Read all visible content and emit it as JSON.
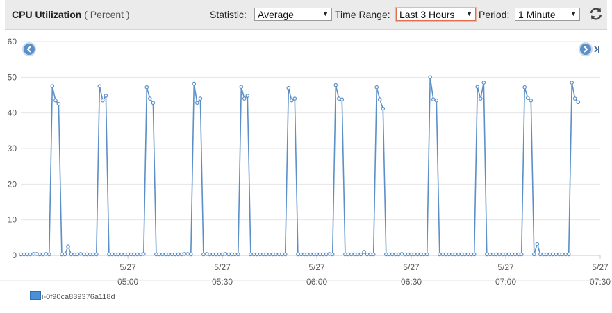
{
  "header": {
    "title": "CPU Utilization",
    "unit": "( Percent )"
  },
  "controls": {
    "statistic_label": "Statistic:",
    "statistic_value": "Average",
    "time_range_label": "Time Range:",
    "time_range_value": "Last 3 Hours",
    "period_label": "Period:",
    "period_value": "1 Minute"
  },
  "icons": {
    "refresh": "refresh-icon",
    "pan_left": "chevron-left-circle-icon",
    "pan_right": "chevron-right-circle-icon",
    "jump_latest": "jump-to-end-icon"
  },
  "colors": {
    "series": "#5b8fc7",
    "accent": "#e0704a"
  },
  "chart_data": {
    "type": "line",
    "title": "",
    "xlabel": "",
    "ylabel": "",
    "ylim": [
      0,
      60
    ],
    "yticks": [
      "0",
      "10",
      "20",
      "30",
      "40",
      "50",
      "60"
    ],
    "xticks": [
      {
        "date": "5/27",
        "time": "05:00"
      },
      {
        "date": "5/27",
        "time": "05:30"
      },
      {
        "date": "5/27",
        "time": "06:00"
      },
      {
        "date": "5/27",
        "time": "06:30"
      },
      {
        "date": "5/27",
        "time": "07:00"
      },
      {
        "date": "5/27",
        "time": "07:30"
      }
    ],
    "x_start": "04:26",
    "x_end": "07:30",
    "grid": true,
    "legend_position": "bottom-left",
    "series": [
      {
        "name": "i-0f90ca839376a118d",
        "times": [
          "04:26",
          "04:27",
          "04:28",
          "04:29",
          "04:30",
          "04:31",
          "04:32",
          "04:33",
          "04:34",
          "04:35",
          "04:36",
          "04:37",
          "04:38",
          "04:39",
          "04:40",
          "04:41",
          "04:42",
          "04:43",
          "04:44",
          "04:45",
          "04:46",
          "04:47",
          "04:48",
          "04:49",
          "04:50",
          "04:51",
          "04:52",
          "04:53",
          "04:54",
          "04:55",
          "04:56",
          "04:57",
          "04:58",
          "04:59",
          "05:00",
          "05:01",
          "05:02",
          "05:03",
          "05:04",
          "05:05",
          "05:06",
          "05:07",
          "05:08",
          "05:09",
          "05:10",
          "05:11",
          "05:12",
          "05:13",
          "05:14",
          "05:15",
          "05:16",
          "05:17",
          "05:18",
          "05:19",
          "05:20",
          "05:21",
          "05:22",
          "05:23",
          "05:24",
          "05:25",
          "05:26",
          "05:27",
          "05:28",
          "05:29",
          "05:30",
          "05:31",
          "05:32",
          "05:33",
          "05:34",
          "05:35",
          "05:36",
          "05:37",
          "05:38",
          "05:39",
          "05:40",
          "05:41",
          "05:42",
          "05:43",
          "05:44",
          "05:45",
          "05:46",
          "05:47",
          "05:48",
          "05:49",
          "05:50",
          "05:51",
          "05:52",
          "05:53",
          "05:54",
          "05:55",
          "05:56",
          "05:57",
          "05:58",
          "05:59",
          "06:00",
          "06:01",
          "06:02",
          "06:03",
          "06:04",
          "06:05",
          "06:06",
          "06:07",
          "06:08",
          "06:09",
          "06:10",
          "06:11",
          "06:12",
          "06:13",
          "06:14",
          "06:15",
          "06:16",
          "06:17",
          "06:18",
          "06:19",
          "06:20",
          "06:21",
          "06:22",
          "06:23",
          "06:24",
          "06:25",
          "06:26",
          "06:27",
          "06:28",
          "06:29",
          "06:30",
          "06:31",
          "06:32",
          "06:33",
          "06:34",
          "06:35",
          "06:36",
          "06:37",
          "06:38",
          "06:39",
          "06:40",
          "06:41",
          "06:42",
          "06:43",
          "06:44",
          "06:45",
          "06:46",
          "06:47",
          "06:48",
          "06:49",
          "06:50",
          "06:51",
          "06:52",
          "06:53",
          "06:54",
          "06:55",
          "06:56",
          "06:57",
          "06:58",
          "06:59",
          "07:00",
          "07:01",
          "07:02",
          "07:03",
          "07:04",
          "07:05",
          "07:06",
          "07:07",
          "07:08",
          "07:09",
          "07:10",
          "07:11",
          "07:12",
          "07:13",
          "07:14",
          "07:15",
          "07:16",
          "07:17",
          "07:18",
          "07:19",
          "07:20",
          "07:21",
          "07:22",
          "07:23",
          "07:24",
          "07:25",
          "07:26",
          "07:27",
          "07:28",
          "07:29",
          "07:30"
        ],
        "values": [
          0.3,
          0.3,
          0.3,
          0.3,
          0.4,
          0.4,
          0.3,
          0.3,
          0.4,
          0.3,
          47.5,
          43.5,
          42.5,
          0.3,
          0.3,
          2.5,
          0.3,
          0.3,
          0.3,
          0.4,
          0.3,
          0.3,
          0.3,
          0.3,
          0.3,
          47.5,
          43.5,
          44.8,
          0.3,
          0.3,
          0.3,
          0.3,
          0.3,
          0.3,
          0.3,
          0.3,
          0.3,
          0.3,
          0.3,
          0.4,
          47.2,
          44,
          42.8,
          0.3,
          0.3,
          0.3,
          0.3,
          0.3,
          0.3,
          0.3,
          0.3,
          0.3,
          0.4,
          0.4,
          0.3,
          48.2,
          42.8,
          44,
          0.3,
          0.4,
          0.3,
          0.3,
          0.3,
          0.3,
          0.3,
          0.4,
          0.3,
          0.3,
          0.3,
          0.3,
          47.3,
          44,
          44.8,
          0.3,
          0.3,
          0.3,
          0.3,
          0.3,
          0.3,
          0.3,
          0.3,
          0.3,
          0.3,
          0.3,
          0.3,
          47,
          43.5,
          44,
          0.3,
          0.3,
          0.3,
          0.3,
          0.3,
          0.3,
          0.3,
          0.3,
          0.3,
          0.3,
          0.4,
          0.3,
          47.8,
          44,
          43.8,
          0.3,
          0.3,
          0.3,
          0.3,
          0.3,
          0.3,
          1,
          0.3,
          0.3,
          0.3,
          47.2,
          43.8,
          41.2,
          0.3,
          0.3,
          0.3,
          0.3,
          0.3,
          0.4,
          0.3,
          0.3,
          0.3,
          0.3,
          0.3,
          0.3,
          0.3,
          0.3,
          50,
          43.8,
          43.5,
          0.3,
          0.3,
          0.3,
          0.3,
          0.3,
          0.3,
          0.3,
          0.3,
          0.3,
          0.3,
          0.3,
          0.3,
          47.3,
          44,
          48.5,
          0.3,
          0.3,
          0.3,
          0.3,
          0.3,
          0.3,
          0.3,
          0.3,
          0.3,
          0.3,
          0.3,
          0.3,
          47.2,
          44.2,
          43.5,
          0.3,
          3.2,
          0.3,
          0.3,
          0.3,
          0.3,
          0.3,
          0.3,
          0.3,
          0.3,
          0.3,
          0.3,
          48.5,
          44,
          43
        ]
      }
    ]
  }
}
